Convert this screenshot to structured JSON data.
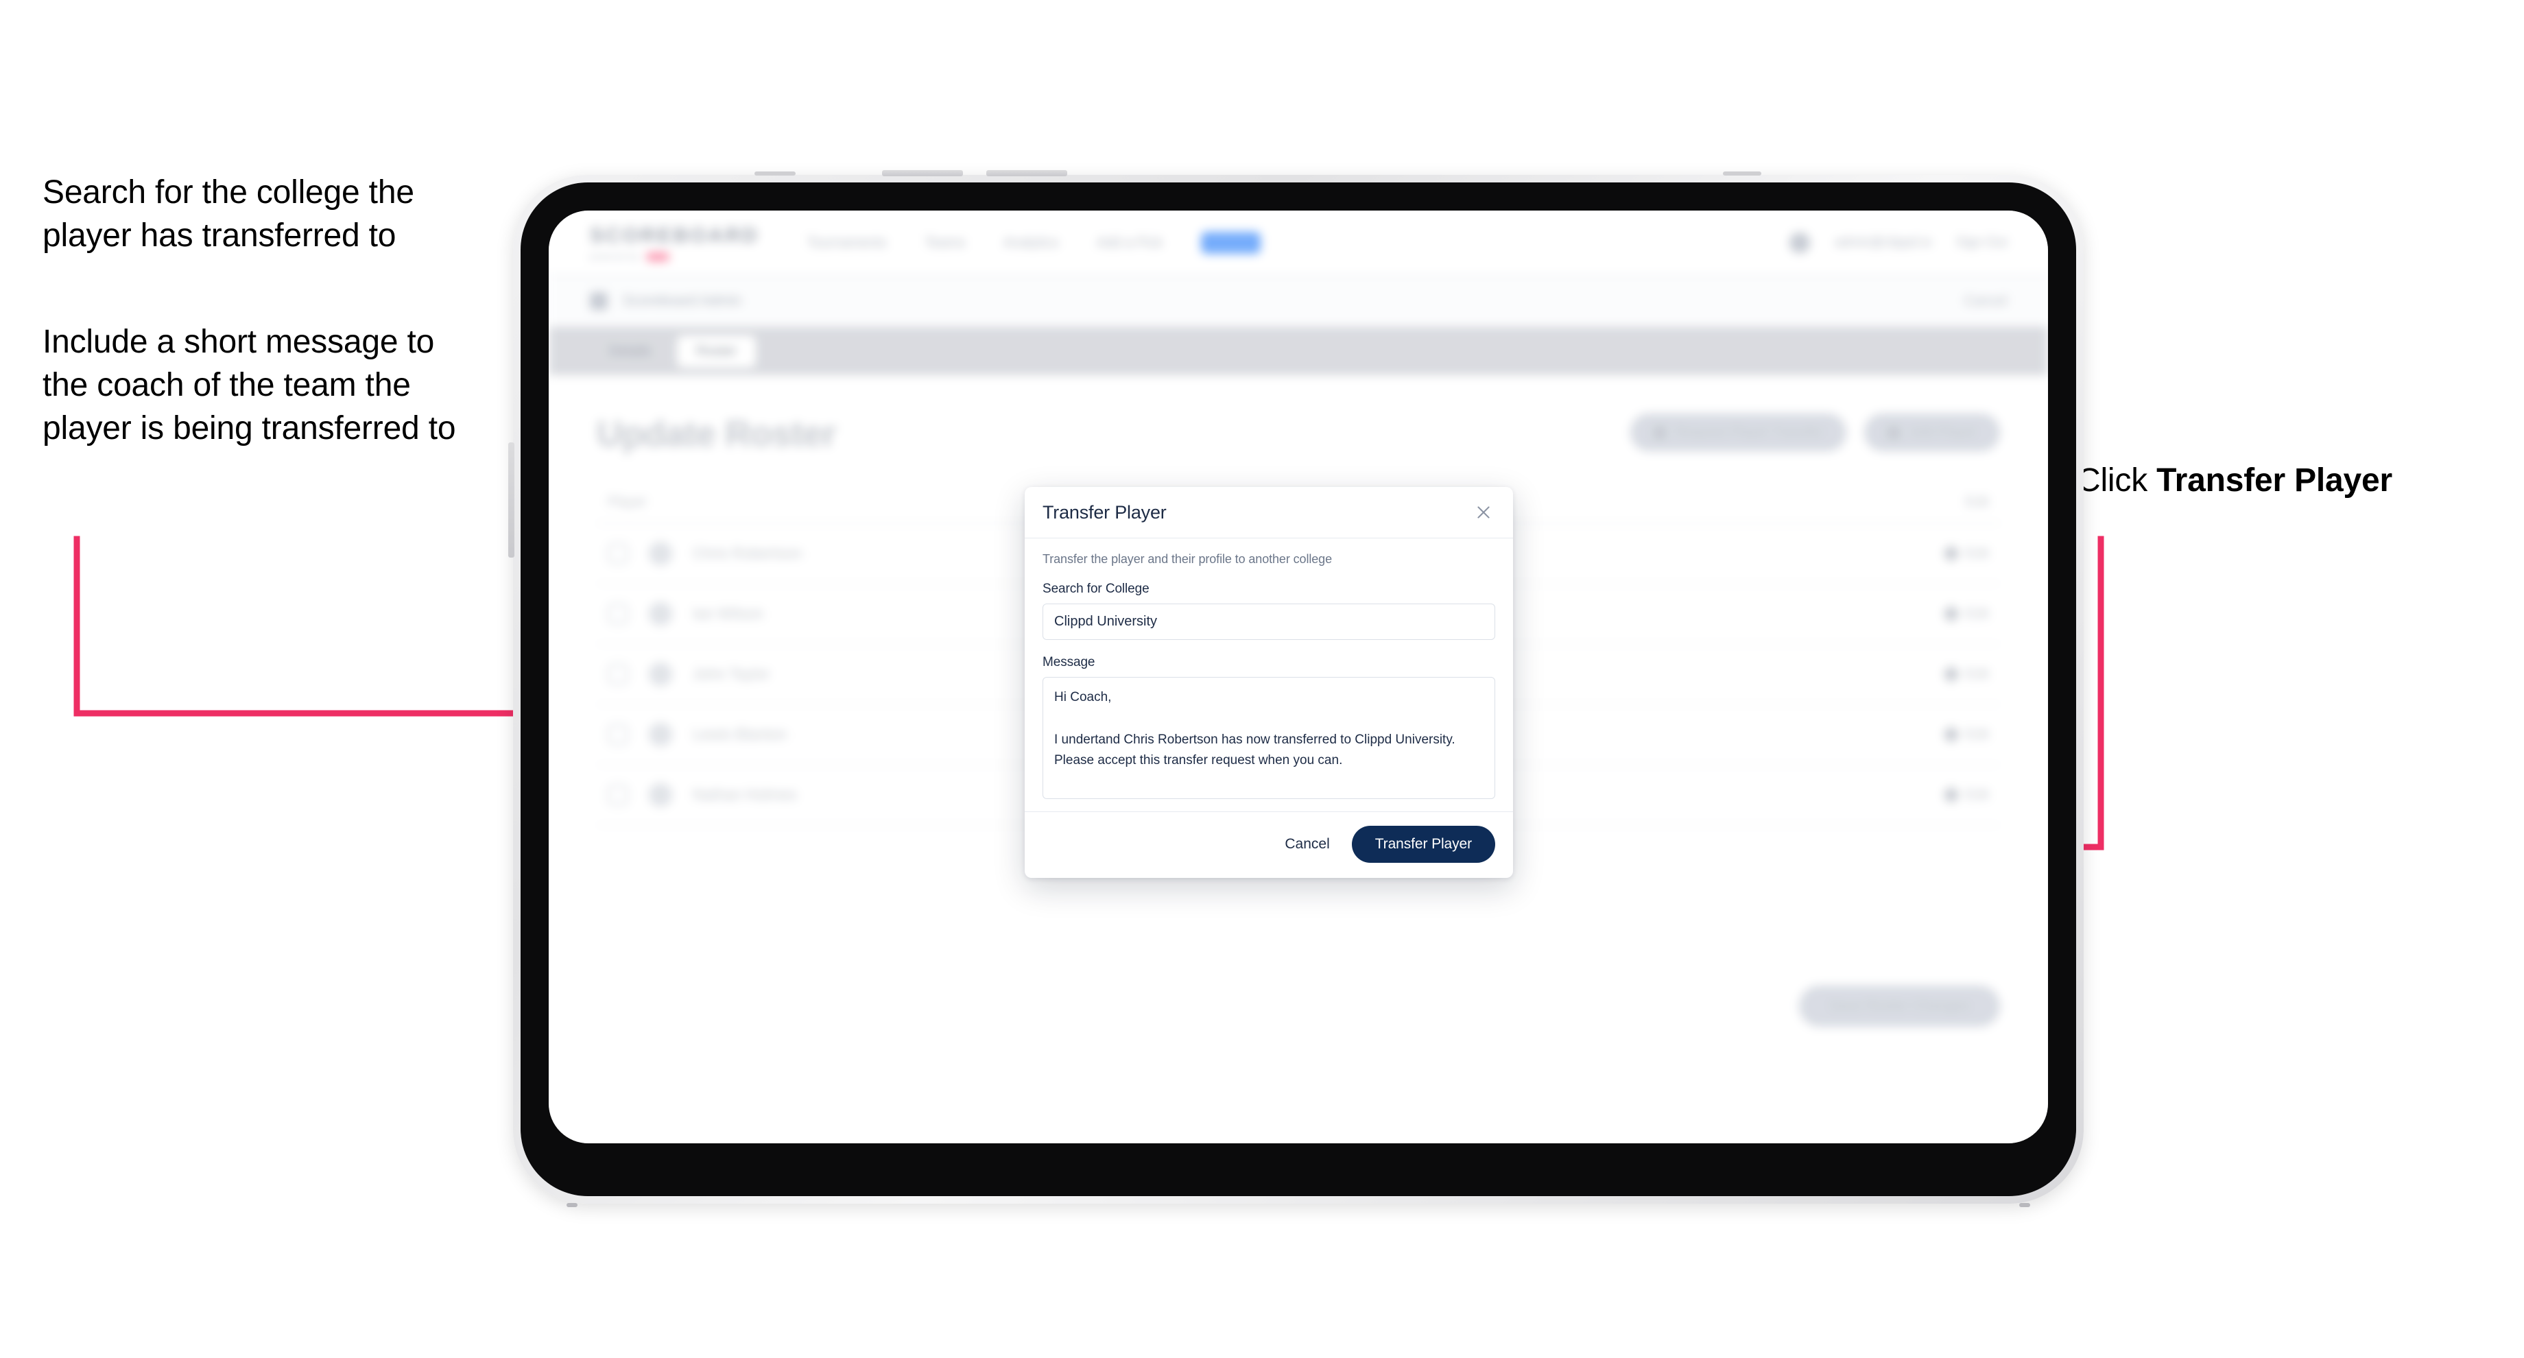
{
  "annotations": {
    "left_top": "Search for the college the player has transferred to",
    "left_bottom": "Include a short message to the coach of the team the player is being transferred to",
    "right_prefix": "Click ",
    "right_emphasis": "Transfer Player",
    "arrow_color": "#ee2e64"
  },
  "modal": {
    "title": "Transfer Player",
    "close_icon": "close-icon",
    "description": "Transfer the player and their profile to another college",
    "college_field": {
      "label": "Search for College",
      "value": "Clippd University",
      "placeholder": "Search for College"
    },
    "message_field": {
      "label": "Message",
      "value": "Hi Coach,\n\nI undertand Chris Robertson has now transferred to Clippd University. Please accept this transfer request when you can.",
      "placeholder": "Message"
    },
    "cancel_label": "Cancel",
    "submit_label": "Transfer Player",
    "submit_color": "#0e2c57"
  },
  "app": {
    "brand": {
      "word": "SCOREBOARD",
      "subtext": "powered by",
      "accent": "#f73a6a"
    },
    "nav_links": [
      "Tournaments",
      "Teams",
      "Analytics",
      "Add a Pick",
      "Roster"
    ],
    "nav_user": "admin@clippd.io",
    "nav_signout": "Sign Out",
    "subbar": {
      "title": "Scoreboard Admin",
      "action": "Cancel"
    },
    "tabs": [
      {
        "label": "Details",
        "active": false
      },
      {
        "label": "Roster",
        "active": true
      }
    ],
    "page_title": "Update Roster",
    "page_actions": [
      "Request Player Transfer",
      "Add Player"
    ],
    "roster": {
      "columns": [
        "Player",
        "Edit"
      ],
      "rows": [
        {
          "name": "Chris Robertson",
          "edit": "Edit"
        },
        {
          "name": "Ian Wilson",
          "edit": "Edit"
        },
        {
          "name": "John Taylor",
          "edit": "Edit"
        },
        {
          "name": "Lewis Blanton",
          "edit": "Edit"
        },
        {
          "name": "Nathan Holmes",
          "edit": "Edit"
        }
      ]
    },
    "bottom_cta": "Save Roster Changes"
  }
}
